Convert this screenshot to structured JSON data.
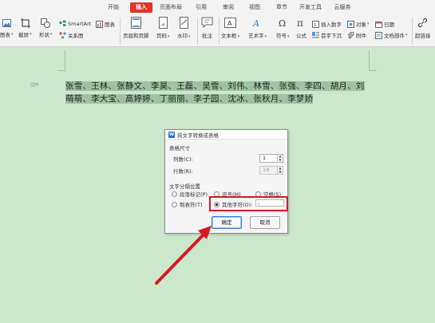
{
  "ribbon": {
    "tabs": [
      {
        "label": "开始",
        "active": false
      },
      {
        "label": "插入",
        "active": true
      },
      {
        "label": "页面布局",
        "active": false
      },
      {
        "label": "引用",
        "active": false
      },
      {
        "label": "审阅",
        "active": false
      },
      {
        "label": "视图",
        "active": false
      },
      {
        "label": "章节",
        "active": false
      },
      {
        "label": "开发工具",
        "active": false
      },
      {
        "label": "云服务",
        "active": false
      }
    ],
    "tools": {
      "chart_small": "图表",
      "screenshot": "截屏",
      "shape": "形状",
      "smartart": "SmartArt",
      "chart": "图表",
      "relation": "关系图",
      "header_footer": "页眉和页脚",
      "page_number": "页码",
      "watermark": "水印",
      "comment": "批注",
      "textbox": "文本框",
      "wordart": "艺术字",
      "symbol": "符号",
      "formula": "公式",
      "insert_number": "插入数字",
      "object": "对象",
      "attachment": "附件",
      "dropcap": "首字下沉",
      "docpart": "文档部件",
      "date": "日期",
      "hyperlink": "超链接"
    },
    "accent_color": "#e0342a"
  },
  "document": {
    "text": "张雪、王林、张静文、李昊、王磊、吴雪、刘伟、林雪、张强、李四、胡月、刘萌萌、李大宝、高婷婷、丁丽丽、李子园、沈冰、张秋月、李梦娇"
  },
  "dialog": {
    "title": "将文字转换成表格",
    "size_section": "表格尺寸",
    "columns_label": "列数(C):",
    "columns_value": "1",
    "rows_label": "行数(R):",
    "rows_value": "19",
    "separator_section": "文字分隔位置",
    "options": {
      "paragraph": "段落标记(P)",
      "comma": "逗号(M)",
      "space": "空格(S)",
      "tab": "制表符(T)",
      "other": "其他字符(O):"
    },
    "selected_option": "other",
    "other_value": "、",
    "ok_label": "确定",
    "cancel_label": "取消"
  },
  "annotation": {
    "highlight_color": "#d9181f"
  }
}
